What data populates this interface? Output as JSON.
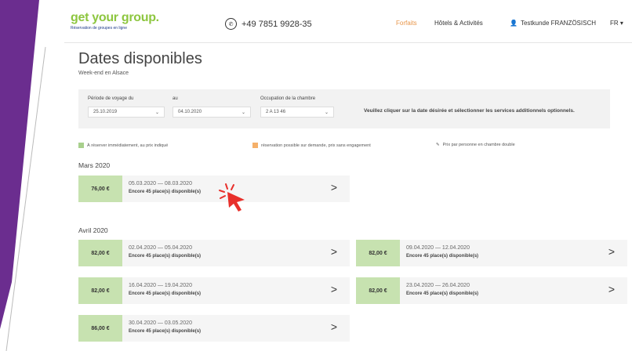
{
  "colors": {
    "purple": "#6b2d8f",
    "green": "#c7e2b0",
    "orange": "#f5b06a",
    "accent": "#e8964a"
  },
  "header": {
    "logo": "get your group.",
    "logo_sub": "Réservation de groupes en ligne",
    "phone": "+49 7851 9928-35",
    "nav_forfaits": "Forfaits",
    "nav_hotels": "Hôtels & Activités",
    "nav_user": "Testkunde FRANZÖSISCH",
    "nav_lang": "FR ▾"
  },
  "page": {
    "title": "Dates disponibles",
    "subtitle": "Week-end en Alsace"
  },
  "filters": {
    "from_label": "Période de voyage du",
    "from_value": "25.10.2019",
    "to_label": "au",
    "to_value": "04.10.2020",
    "room_label": "Occupation de la chambre",
    "room_value": "2 A   13 46",
    "note": "Veuillez cliquer sur la date désirée et sélectionner les services additionnels optionnels."
  },
  "legend": {
    "green_text": "À réserver immédiatement, au prix indiqué",
    "orange_text": "réservation possible sur demande, prix sans engagement",
    "price_text": "Prix par personne en chambre double"
  },
  "months": [
    {
      "name": "Mars 2020",
      "items": [
        {
          "price": "76,00 €",
          "dates": "05.03.2020 — 08.03.2020",
          "avail": "Encore 45 place(s) disponible(s)"
        }
      ]
    },
    {
      "name": "Avril 2020",
      "items": [
        {
          "price": "82,00 €",
          "dates": "02.04.2020 — 05.04.2020",
          "avail": "Encore 45 place(s) disponible(s)"
        },
        {
          "price": "82,00 €",
          "dates": "09.04.2020 — 12.04.2020",
          "avail": "Encore 45 place(s) disponible(s)"
        },
        {
          "price": "82,00 €",
          "dates": "16.04.2020 — 19.04.2020",
          "avail": "Encore 45 place(s) disponible(s)"
        },
        {
          "price": "82,00 €",
          "dates": "23.04.2020 — 26.04.2020",
          "avail": "Encore 45 place(s) disponible(s)"
        },
        {
          "price": "86,00 €",
          "dates": "30.04.2020 — 03.05.2020",
          "avail": "Encore 45 place(s) disponible(s)"
        }
      ]
    }
  ]
}
